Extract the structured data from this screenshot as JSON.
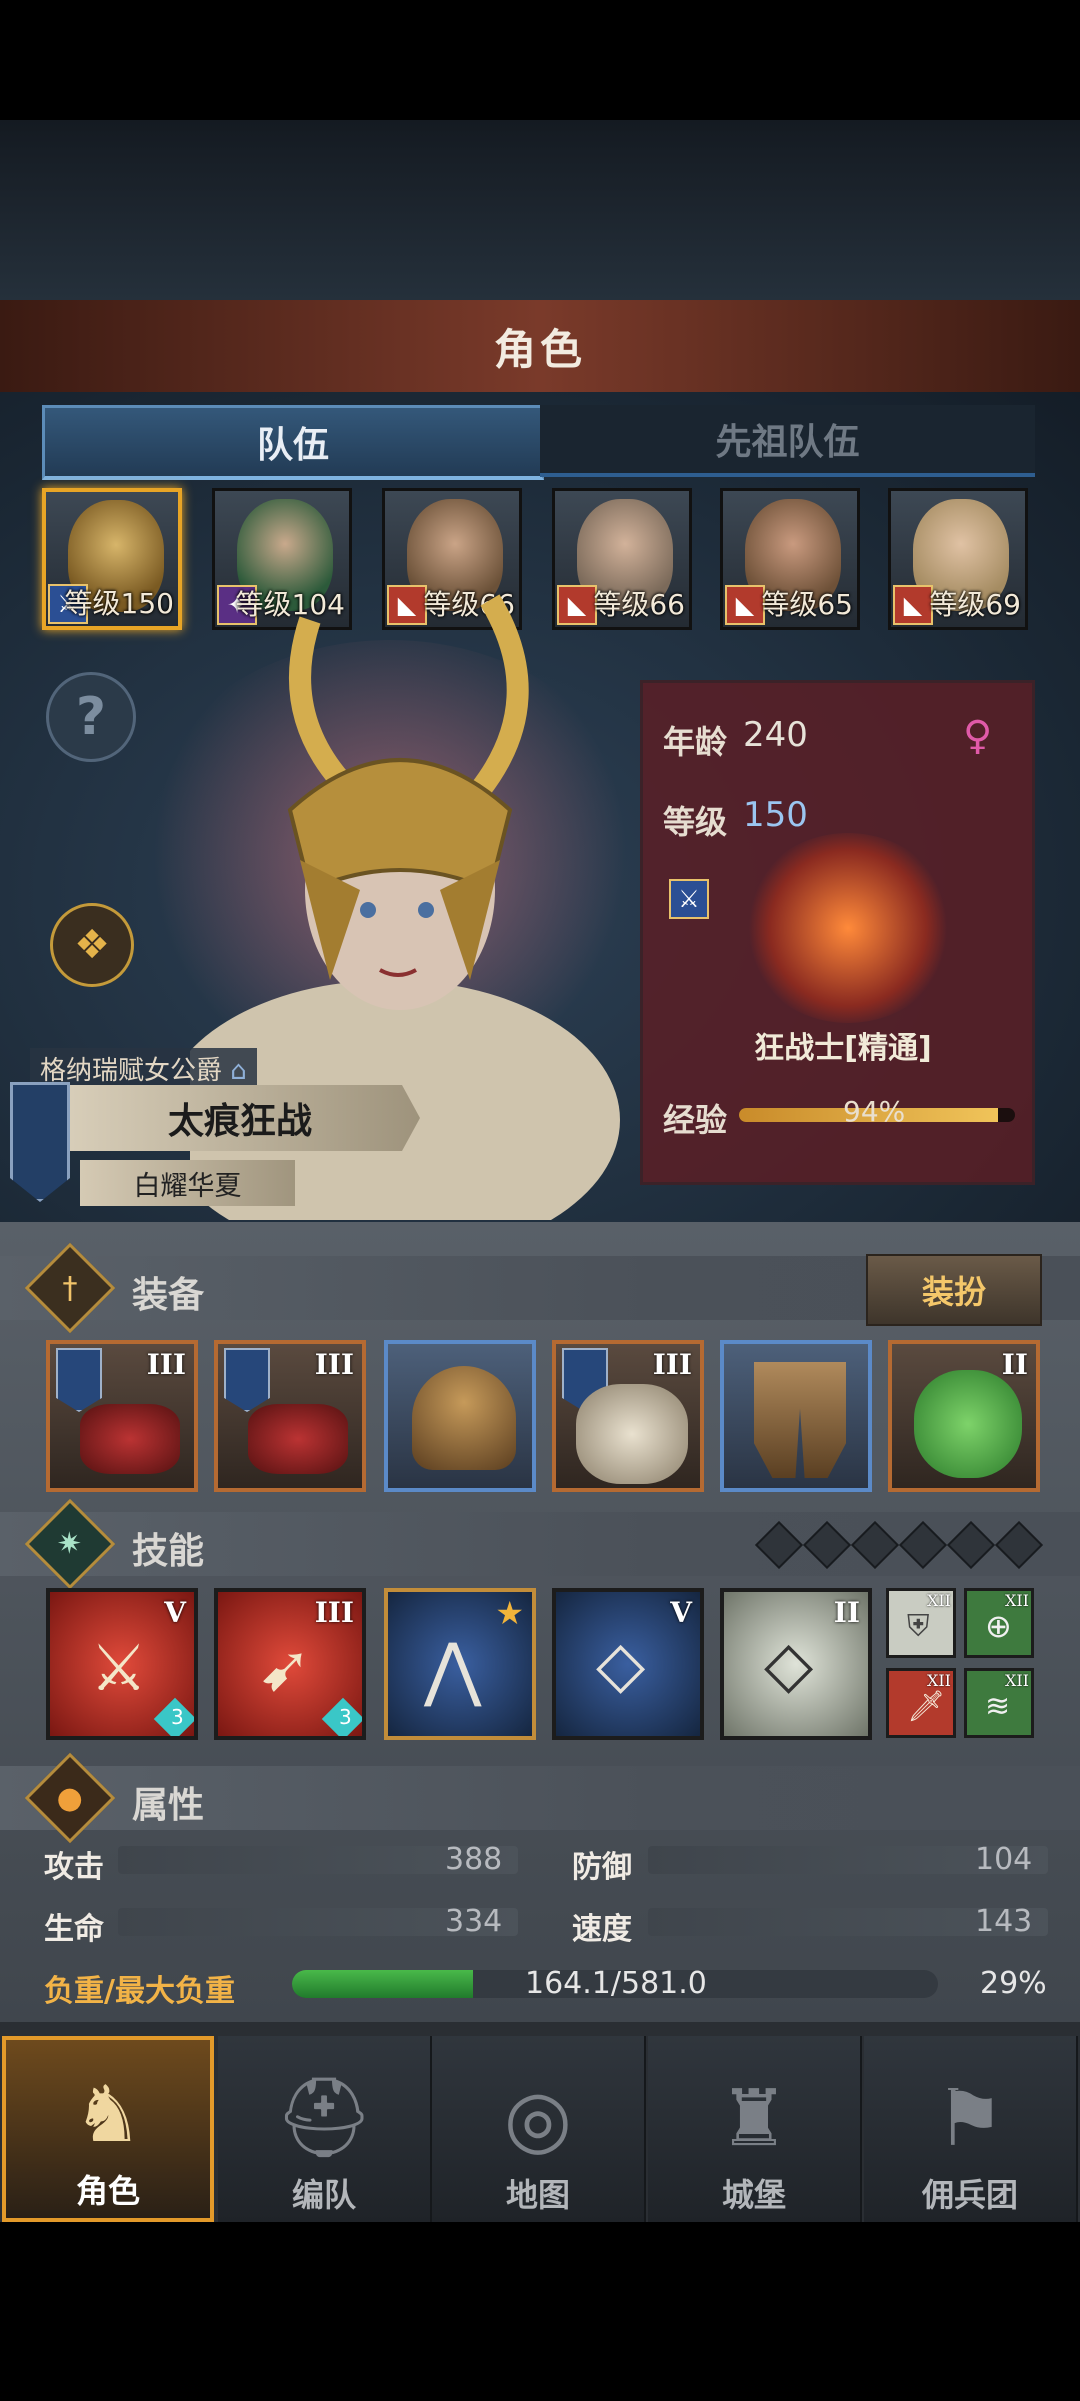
{
  "header": {
    "title": "角色"
  },
  "tabs": [
    {
      "label": "队伍",
      "active": true
    },
    {
      "label": "先祖队伍",
      "active": false
    }
  ],
  "team": [
    {
      "level": "等级150",
      "class_icon": "sword-icon",
      "selected": true
    },
    {
      "level": "等级104",
      "class_icon": "staff-icon",
      "selected": false
    },
    {
      "level": "等级66",
      "class_icon": "wolf-icon",
      "selected": false
    },
    {
      "level": "等级66",
      "class_icon": "wolf-icon",
      "selected": false
    },
    {
      "level": "等级65",
      "class_icon": "wolf-icon",
      "selected": false
    },
    {
      "level": "等级69",
      "class_icon": "wolf-icon",
      "selected": false
    }
  ],
  "character": {
    "noble_title": "格纳瑞赋女公爵",
    "name": "太痕狂战",
    "subtitle": "白耀华夏",
    "age_label": "年龄",
    "age_value": "240",
    "level_label": "等级",
    "level_value": "150",
    "class_name": "狂战士[精通]",
    "exp_label": "经验",
    "exp_percent": "94%",
    "exp_fraction": 0.94,
    "gender_icon": "female-icon"
  },
  "equipment": {
    "title": "装备",
    "dress_button": "装扮",
    "slots": [
      {
        "tier": "III",
        "icon": "axe-icon",
        "rarity": "orange",
        "banner": true
      },
      {
        "tier": "III",
        "icon": "axe-icon",
        "rarity": "orange",
        "banner": true
      },
      {
        "tier": "",
        "icon": "helmet-icon",
        "rarity": "blue",
        "banner": false
      },
      {
        "tier": "III",
        "icon": "fur-armor-icon",
        "rarity": "orange",
        "banner": true
      },
      {
        "tier": "",
        "icon": "boots-icon",
        "rarity": "blue",
        "banner": false
      },
      {
        "tier": "II",
        "icon": "jade-charm-icon",
        "rarity": "orange",
        "banner": false
      }
    ]
  },
  "skills": {
    "title": "技能",
    "main": [
      {
        "tier": "V",
        "icon": "cleave-icon",
        "color": "red",
        "badge": "3"
      },
      {
        "tier": "III",
        "icon": "charge-icon",
        "color": "red",
        "badge": "3"
      },
      {
        "tier": "",
        "icon": "claw-icon",
        "color": "blue",
        "badge": "★"
      },
      {
        "tier": "V",
        "icon": "crystal-strike-icon",
        "color": "blue",
        "badge": ""
      },
      {
        "tier": "II",
        "icon": "crystal-guard-icon",
        "color": "grey",
        "badge": ""
      }
    ],
    "passive": [
      {
        "tier": "XII",
        "icon": "shield-plus-icon"
      },
      {
        "tier": "XII",
        "icon": "target-icon"
      },
      {
        "tier": "XII",
        "icon": "blade-icon"
      },
      {
        "tier": "XII",
        "icon": "wing-icon"
      }
    ]
  },
  "attributes": {
    "title": "属性",
    "items": [
      {
        "label": "攻击",
        "value": "388"
      },
      {
        "label": "防御",
        "value": "104"
      },
      {
        "label": "生命",
        "value": "334"
      },
      {
        "label": "速度",
        "value": "143"
      }
    ],
    "load_label": "负重/最大负重",
    "load_value": "164.1/581.0",
    "load_percent": "29%",
    "load_fraction": 0.28
  },
  "nav": [
    {
      "label": "角色",
      "icon": "knight-icon",
      "active": true
    },
    {
      "label": "编队",
      "icon": "helmet-formation-icon",
      "active": false
    },
    {
      "label": "地图",
      "icon": "compass-map-icon",
      "active": false
    },
    {
      "label": "城堡",
      "icon": "castle-icon",
      "active": false
    },
    {
      "label": "佣兵团",
      "icon": "mercenary-banner-icon",
      "active": false
    }
  ]
}
